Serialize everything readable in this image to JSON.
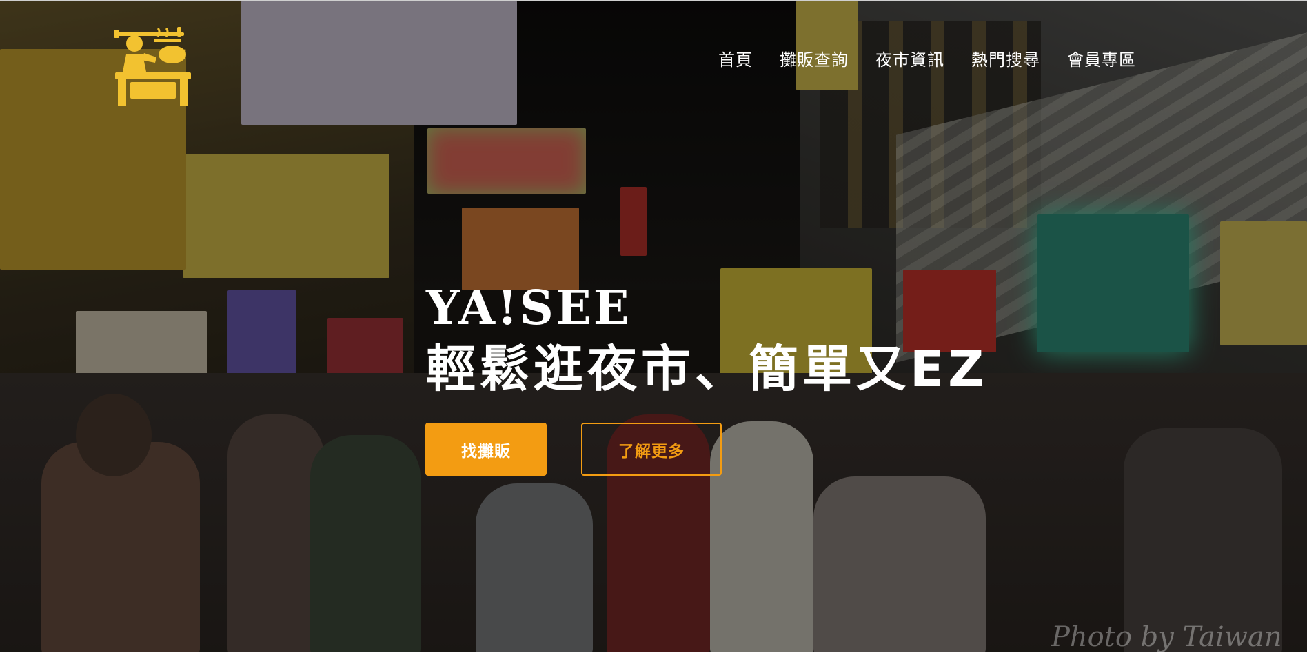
{
  "nav": {
    "items": [
      {
        "label": "首頁"
      },
      {
        "label": "攤販查詢"
      },
      {
        "label": "夜市資訊"
      },
      {
        "label": "熱門搜尋"
      },
      {
        "label": "會員專區"
      }
    ]
  },
  "hero": {
    "brand": "YA!SEE",
    "tagline": "輕鬆逛夜市、簡單又EZ",
    "primary_button": "找攤販",
    "secondary_button": "了解更多",
    "watermark": "Photo by Taiwan"
  },
  "colors": {
    "accent": "#f39c12",
    "logo": "#f2c230",
    "text": "#ffffff"
  },
  "icons": {
    "logo": "food-vendor-stall-icon"
  }
}
